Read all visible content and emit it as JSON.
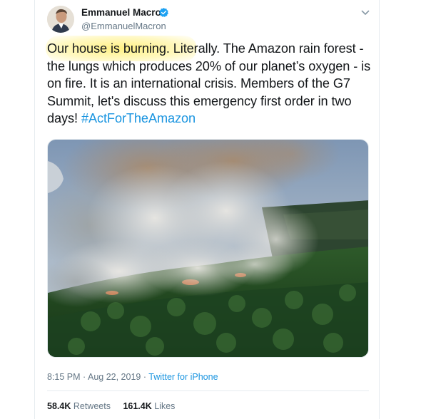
{
  "author": {
    "name": "Emmanuel Macron",
    "handle": "@EmmanuelMacron"
  },
  "tweet": {
    "highlighted_text": "Our house is burning. Liter",
    "text_rest": "ally. The Amazon rain forest - the lungs which produces 20% of our planet’s oxygen - is on fire. It is an international crisis. Members of the G7 Summit, let's discuss this emergency first order in two days! ",
    "hashtag": "#ActForTheAmazon"
  },
  "meta": {
    "time": "8:15 PM",
    "separator1": " · ",
    "date": "Aug 22, 2019",
    "separator2": " · ",
    "source": "Twitter for iPhone"
  },
  "stats": {
    "retweets_count": "58.4K",
    "retweets_label": "Retweets",
    "likes_count": "161.4K",
    "likes_label": "Likes"
  },
  "icons": {
    "verified": "verified-badge-icon",
    "menu": "chevron-down-icon"
  },
  "colors": {
    "link": "#1b95e0",
    "secondary": "#657786",
    "verified": "#1da1f2",
    "highlight": "#ffec5a"
  }
}
